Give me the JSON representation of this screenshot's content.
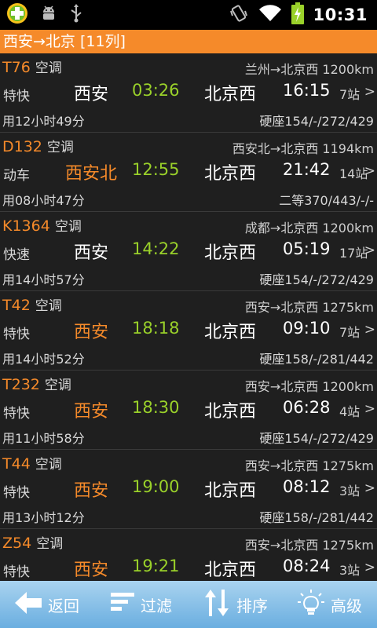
{
  "status_bar": {
    "icons": [
      "app-plus-icon",
      "android-debug-icon",
      "usb-icon",
      "vibrate-icon",
      "wifi-icon",
      "battery-charging-icon"
    ],
    "time": "10:31"
  },
  "header": {
    "title": "西安→北京 [11列]"
  },
  "trains": [
    {
      "number": "T76",
      "ac": "空调",
      "route": "兰州→北京西 1200km",
      "type": "特快",
      "from": "西安",
      "from_color": "white",
      "depart": "03:26",
      "to": "北京西",
      "arrive": "16:15",
      "stops": "7站",
      "duration": "用12小时49分",
      "price": "硬座154/-/272/429"
    },
    {
      "number": "D132",
      "ac": "空调",
      "route": "西安北→北京西 1194km",
      "type": "动车",
      "from": "西安北",
      "from_color": "orange",
      "depart": "12:55",
      "to": "北京西",
      "arrive": "21:42",
      "stops": "14站",
      "duration": "用08小时47分",
      "price": "二等370/443/-/-"
    },
    {
      "number": "K1364",
      "ac": "空调",
      "route": "成都→北京西 1200km",
      "type": "快速",
      "from": "西安",
      "from_color": "white",
      "depart": "14:22",
      "to": "北京西",
      "arrive": "05:19",
      "stops": "17站",
      "duration": "用14小时57分",
      "price": "硬座154/-/272/429"
    },
    {
      "number": "T42",
      "ac": "空调",
      "route": "西安→北京西 1275km",
      "type": "特快",
      "from": "西安",
      "from_color": "orange",
      "depart": "18:18",
      "to": "北京西",
      "arrive": "09:10",
      "stops": "7站",
      "duration": "用14小时52分",
      "price": "硬座158/-/281/442"
    },
    {
      "number": "T232",
      "ac": "空调",
      "route": "西安→北京西 1200km",
      "type": "特快",
      "from": "西安",
      "from_color": "orange",
      "depart": "18:30",
      "to": "北京西",
      "arrive": "06:28",
      "stops": "4站",
      "duration": "用11小时58分",
      "price": "硬座154/-/272/429"
    },
    {
      "number": "T44",
      "ac": "空调",
      "route": "西安→北京西 1275km",
      "type": "特快",
      "from": "西安",
      "from_color": "orange",
      "depart": "19:00",
      "to": "北京西",
      "arrive": "08:12",
      "stops": "3站",
      "duration": "用13小时12分",
      "price": "硬座158/-/281/442"
    },
    {
      "number": "Z54",
      "ac": "空调",
      "route": "西安→北京西 1275km",
      "type": "特快",
      "from": "西安",
      "from_color": "orange",
      "depart": "19:21",
      "to": "北京西",
      "arrive": "08:24",
      "stops": "3站",
      "duration": "",
      "price": ""
    }
  ],
  "chevron": ">",
  "bottom_bar": {
    "back_label": "返回",
    "filter_label": "过滤",
    "sort_label": "排序",
    "advanced_label": "高级"
  },
  "colors": {
    "accent": "#f58a2a",
    "depart_time": "#9ad12a",
    "background": "#1f1f1f",
    "bottom_bar": "#7dbbe6"
  }
}
